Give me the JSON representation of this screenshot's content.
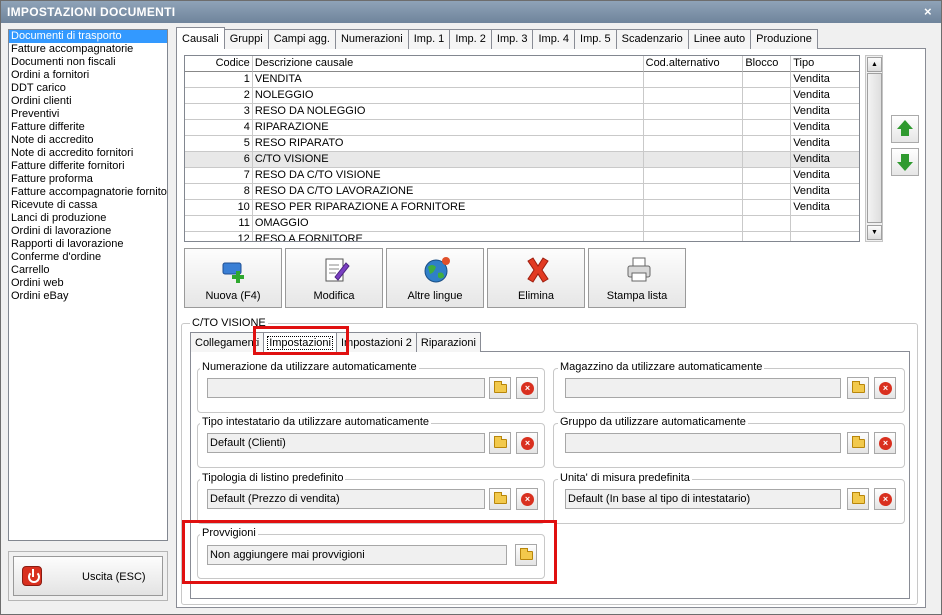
{
  "window": {
    "title": "IMPOSTAZIONI DOCUMENTI",
    "close_glyph": "×"
  },
  "sidebar": {
    "items": [
      "Documenti di trasporto",
      "Fatture accompagnatorie",
      "Documenti non fiscali",
      "Ordini a fornitori",
      "DDT carico",
      "Ordini clienti",
      "Preventivi",
      "Fatture differite",
      "Note di accredito",
      "Note di accredito fornitori",
      "Fatture differite fornitori",
      "Fatture proforma",
      "Fatture accompagnatorie fornito",
      "Ricevute di cassa",
      "Lanci di produzione",
      "Ordini di lavorazione",
      "Rapporti di lavorazione",
      "Conferme d'ordine",
      "Carrello",
      "Ordini web",
      "Ordini eBay"
    ]
  },
  "exit": {
    "label": "Uscita (ESC)"
  },
  "main_tabs": [
    "Causali",
    "Gruppi",
    "Campi agg.",
    "Numerazioni",
    "Imp. 1",
    "Imp. 2",
    "Imp. 3",
    "Imp. 4",
    "Imp. 5",
    "Scadenzario",
    "Linee auto",
    "Produzione"
  ],
  "grid": {
    "headers": [
      "Codice",
      "Descrizione causale",
      "Cod.alternativo",
      "Blocco",
      "Tipo"
    ],
    "rows": [
      [
        "1",
        "VENDITA",
        "",
        "",
        "Vendita"
      ],
      [
        "2",
        "NOLEGGIO",
        "",
        "",
        "Vendita"
      ],
      [
        "3",
        "RESO DA NOLEGGIO",
        "",
        "",
        "Vendita"
      ],
      [
        "4",
        "RIPARAZIONE",
        "",
        "",
        "Vendita"
      ],
      [
        "5",
        "RESO RIPARATO",
        "",
        "",
        "Vendita"
      ],
      [
        "6",
        "C/TO VISIONE",
        "",
        "",
        "Vendita"
      ],
      [
        "7",
        "RESO DA C/TO VISIONE",
        "",
        "",
        "Vendita"
      ],
      [
        "8",
        "RESO DA C/TO LAVORAZIONE",
        "",
        "",
        "Vendita"
      ],
      [
        "10",
        "RESO PER RIPARAZIONE A FORNITORE",
        "",
        "",
        "Vendita"
      ],
      [
        "11",
        "OMAGGIO",
        "",
        "",
        ""
      ],
      [
        "12",
        "RESO A FORNITORE",
        "",
        "",
        ""
      ]
    ],
    "selected_index": 5
  },
  "toolbar": {
    "new": "Nuova (F4)",
    "edit": "Modifica",
    "languages": "Altre lingue",
    "delete": "Elimina",
    "print": "Stampa lista"
  },
  "section": {
    "title": "C/TO VISIONE"
  },
  "sub_tabs": [
    "Collegamenti",
    "Impostazioni",
    "Impostazioni 2",
    "Riparazioni"
  ],
  "settings": {
    "numerazione": {
      "label": "Numerazione da utilizzare automaticamente",
      "value": ""
    },
    "magazzino": {
      "label": "Magazzino da utilizzare automaticamente",
      "value": ""
    },
    "tipo_intestatario": {
      "label": "Tipo intestatario da utilizzare automaticamente",
      "value": "Default (Clienti)"
    },
    "gruppo": {
      "label": "Gruppo da utilizzare automaticamente",
      "value": ""
    },
    "tipologia_listino": {
      "label": "Tipologia di listino predefinito",
      "value": "Default (Prezzo di vendita)"
    },
    "unita_misura": {
      "label": "Unita' di misura predefinita",
      "value": "Default (In base al tipo di intestatario)"
    },
    "provvigioni": {
      "label": "Provvigioni",
      "value": "Non aggiungere mai provvigioni"
    }
  },
  "colors": {
    "highlight": "#e01010",
    "selection": "#3399ff",
    "titlebar": "#7b8fa5"
  }
}
